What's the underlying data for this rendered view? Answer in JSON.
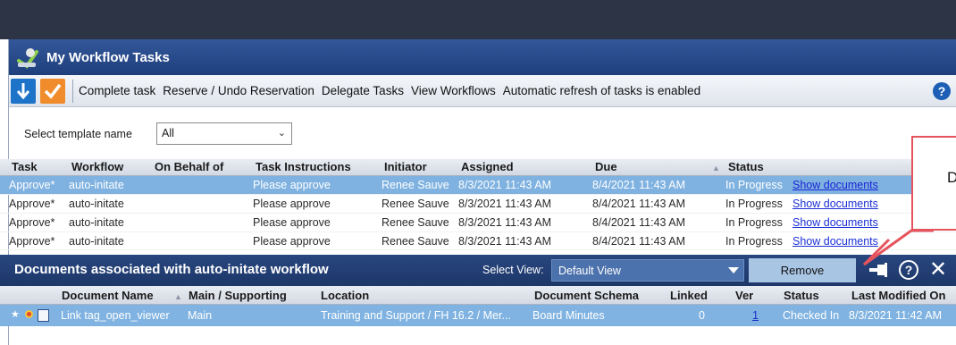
{
  "app": {
    "title": "My Workflow Tasks"
  },
  "toolbar": {
    "items": [
      "Complete task",
      "Reserve / Undo Reservation",
      "Delegate Tasks",
      "View Workflows",
      "Automatic refresh of tasks is enabled"
    ],
    "help": "?"
  },
  "filter": {
    "label": "Select template name",
    "value": "All"
  },
  "tasks": {
    "columns": [
      "Task",
      "Workflow",
      "On Behalf of",
      "Task Instructions",
      "Initiator",
      "Assigned",
      "Due",
      "Status"
    ],
    "rows": [
      {
        "task": "Approve*",
        "workflow": "auto-initate",
        "instructions": "Please approve",
        "initiator": "Renee Sauve",
        "assigned": "8/3/2021 11:43 AM",
        "due": "8/4/2021 11:43 AM",
        "status": "In Progress",
        "link": "Show documents"
      },
      {
        "task": "Approve*",
        "workflow": "auto-initate",
        "instructions": "Please approve",
        "initiator": "Renee Sauve",
        "assigned": "8/3/2021 11:43 AM",
        "due": "8/4/2021 11:43 AM",
        "status": "In Progress",
        "link": "Show documents"
      },
      {
        "task": "Approve*",
        "workflow": "auto-initate",
        "instructions": "Please approve",
        "initiator": "Renee Sauve",
        "assigned": "8/3/2021 11:43 AM",
        "due": "8/4/2021 11:43 AM",
        "status": "In Progress",
        "link": "Show documents"
      },
      {
        "task": "Approve*",
        "workflow": "auto-initate",
        "instructions": "Please approve",
        "initiator": "Renee Sauve",
        "assigned": "8/3/2021 11:43 AM",
        "due": "8/4/2021 11:43 AM",
        "status": "In Progress",
        "link": "Show documents"
      }
    ]
  },
  "docs": {
    "title": "Documents associated with auto-initate workflow",
    "select_view_label": "Select View:",
    "select_view_value": "Default View",
    "remove_label": "Remove",
    "columns": [
      "Document Name",
      "Main / Supporting",
      "Location",
      "Document Schema",
      "Linked",
      "Ver",
      "Status",
      "Last Modified On"
    ],
    "row": {
      "name": "Link tag_open_viewer",
      "main": "Main",
      "location": "Training and Support / FH 16.2 / Mer...",
      "schema": "Board Minutes",
      "linked": "0",
      "ver": "1",
      "status": "Checked In",
      "modified": "8/3/2021 11:42 AM"
    }
  },
  "callout": {
    "text": "D"
  },
  "colors": {
    "accent": "#1f3f7c",
    "selected_row": "#7fb2e0",
    "callout_border": "#e5545d"
  }
}
